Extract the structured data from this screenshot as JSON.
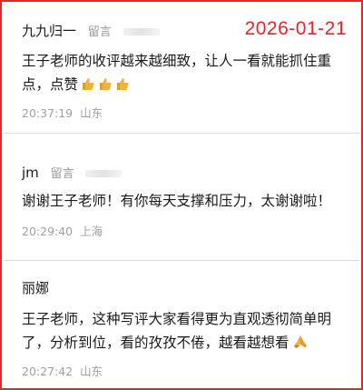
{
  "date_stamp": "2026-01-21",
  "comments": [
    {
      "author": "九九归一",
      "tag": "留言",
      "text": "王子老师的收评越来越细致，让人一看就能抓住重点，点赞",
      "emoji": [
        "thumbs-up-icon",
        "thumbs-up-icon",
        "thumbs-up-icon"
      ],
      "time": "20:37:19",
      "location": "山东"
    },
    {
      "author": "jm",
      "tag": "留言",
      "text": "谢谢王子老师！有你每天支撑和压力，太谢谢啦！",
      "emoji": [],
      "time": "20:29:40",
      "location": "上海"
    },
    {
      "author": "丽娜",
      "tag": "",
      "text": "王子老师，这种写评大家看得更为直观透彻简单明了，分析到位，看的孜孜不倦，越看越想看",
      "emoji": [
        "praying-hands-icon"
      ],
      "time": "20:27:42",
      "location": "山东"
    }
  ],
  "colors": {
    "frame": "#e8252a",
    "date_stamp": "#e8252a",
    "meta_text": "#a0a0a0",
    "body_text": "#1a1a1a",
    "emoji_thumb": "#f2b233"
  }
}
